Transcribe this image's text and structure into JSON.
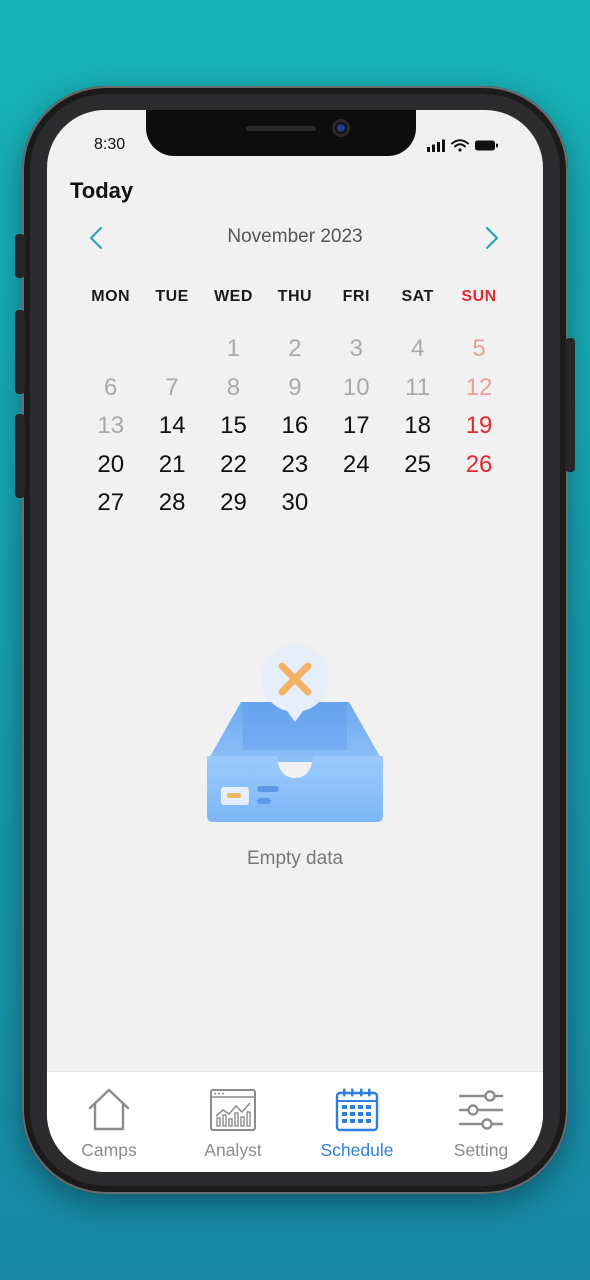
{
  "status_bar": {
    "time": "8:30"
  },
  "header": {
    "title": "Today"
  },
  "calendar": {
    "month_label": "November 2023",
    "weekdays": [
      "MON",
      "TUE",
      "WED",
      "THU",
      "FRI",
      "SAT",
      "SUN"
    ],
    "weeks": [
      [
        {
          "d": ""
        },
        {
          "d": ""
        },
        {
          "d": "1",
          "muted": true
        },
        {
          "d": "2",
          "muted": true
        },
        {
          "d": "3",
          "muted": true
        },
        {
          "d": "4",
          "muted": true
        },
        {
          "d": "5",
          "muted": true,
          "sunday": true
        }
      ],
      [
        {
          "d": "6",
          "muted": true
        },
        {
          "d": "7",
          "muted": true
        },
        {
          "d": "8",
          "muted": true
        },
        {
          "d": "9",
          "muted": true
        },
        {
          "d": "10",
          "muted": true
        },
        {
          "d": "11",
          "muted": true
        },
        {
          "d": "12",
          "muted": true,
          "sunday": true
        }
      ],
      [
        {
          "d": "13",
          "muted": true
        },
        {
          "d": "14"
        },
        {
          "d": "15"
        },
        {
          "d": "16"
        },
        {
          "d": "17"
        },
        {
          "d": "18"
        },
        {
          "d": "19",
          "sunday": true
        }
      ],
      [
        {
          "d": "20"
        },
        {
          "d": "21"
        },
        {
          "d": "22"
        },
        {
          "d": "23"
        },
        {
          "d": "24"
        },
        {
          "d": "25"
        },
        {
          "d": "26",
          "sunday": true
        }
      ],
      [
        {
          "d": "27"
        },
        {
          "d": "28"
        },
        {
          "d": "29"
        },
        {
          "d": "30"
        },
        {
          "d": ""
        },
        {
          "d": ""
        },
        {
          "d": ""
        }
      ]
    ],
    "prev_icon": "chevron-left-icon",
    "next_icon": "chevron-right-icon"
  },
  "empty_state": {
    "icon": "empty-inbox-icon",
    "message": "Empty data"
  },
  "tab_bar": {
    "tabs": [
      {
        "id": "camps",
        "label": "Camps",
        "icon": "home-icon",
        "active": false
      },
      {
        "id": "analyst",
        "label": "Analyst",
        "icon": "analytics-icon",
        "active": false
      },
      {
        "id": "schedule",
        "label": "Schedule",
        "icon": "calendar-icon",
        "active": true
      },
      {
        "id": "setting",
        "label": "Setting",
        "icon": "sliders-icon",
        "active": false
      }
    ]
  },
  "colors": {
    "accent": "#2f7fe0",
    "arrow": "#2aa4b8",
    "sunday": "#e3282d",
    "background": "#f1f1f1"
  }
}
